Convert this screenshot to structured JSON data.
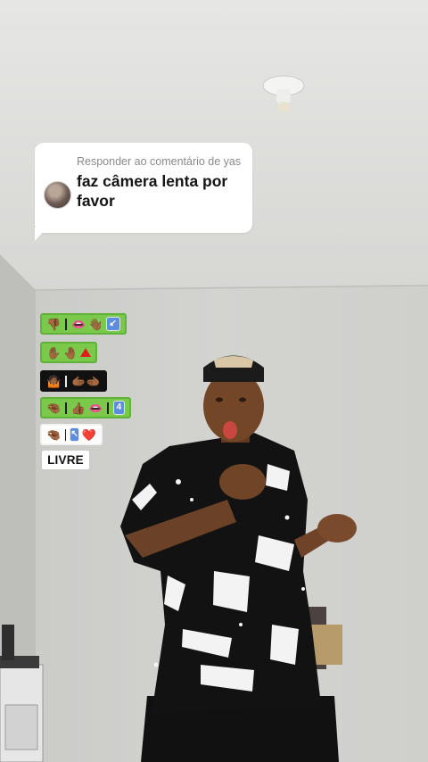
{
  "reply": {
    "header": "Responder ao comentário de yas",
    "text": "faz câmera lenta por favor"
  },
  "stickers": [
    {
      "style": "green",
      "left_icons": [
        "thumbs-down-icon"
      ],
      "right_icons": [
        "lips-icon",
        "waving-hand-icon",
        "arrow-down-left-icon"
      ]
    },
    {
      "style": "green",
      "left_icons": [
        "raised-hand-icon",
        "raised-hand-icon",
        "red-triangle-icon"
      ]
    },
    {
      "style": "black",
      "left_icons": [
        "person-shrugging-icon"
      ],
      "right_icons": [
        "pointing-hands-icon"
      ]
    },
    {
      "style": "green",
      "left_icons": [
        "pinching-hand-icon"
      ],
      "right_icons": [
        "thumbs-up-icon",
        "lips-icon"
      ],
      "extra_icons": [
        "keycap-4-icon"
      ]
    },
    {
      "style": "white",
      "left_icons": [
        "pinching-hand-icon"
      ],
      "right_icons": [
        "arrow-up-left-icon",
        "heart-icon"
      ]
    }
  ],
  "badge": {
    "label": "LIVRE"
  },
  "keycaps": {
    "four": "4"
  },
  "colors": {
    "bubble": "#ffffff",
    "sticker_green": "#7ac94b",
    "sticker_black": "#111111",
    "badge": "#ffffff"
  }
}
